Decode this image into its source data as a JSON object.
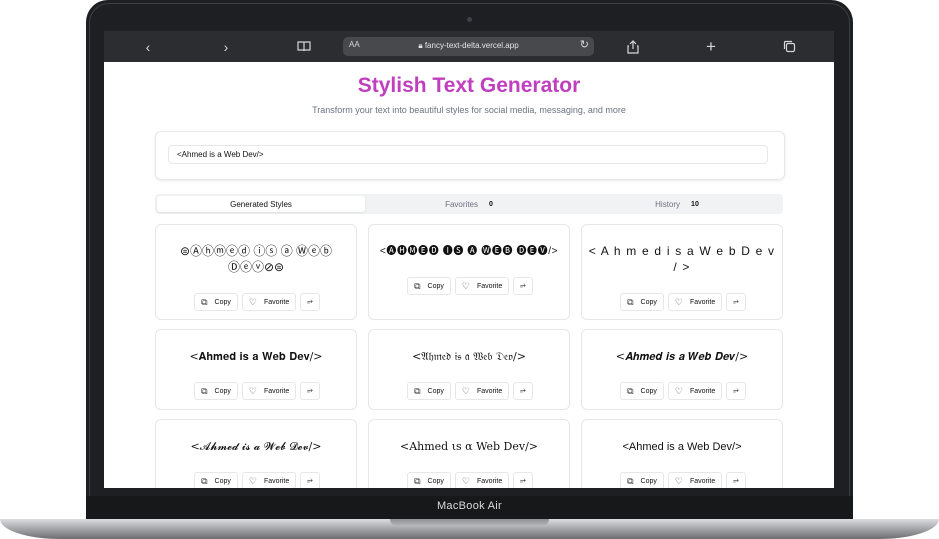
{
  "device": {
    "label": "MacBook Air"
  },
  "browser": {
    "text_size": "AA",
    "url": "fancy-text-delta.vercel.app",
    "icons": [
      "back-icon",
      "forward-icon",
      "reader-icon",
      "lock-icon",
      "reload-icon",
      "share-icon",
      "new-tab-icon",
      "tabs-icon"
    ]
  },
  "page": {
    "title": "Stylish Text Generator",
    "subtitle": "Transform your text into beautiful styles for social media, messaging, and more",
    "title_color": "#bf3fbf",
    "input_value": "<Ahmed is a Web Dev/>"
  },
  "tabs": [
    {
      "label": "Generated Styles",
      "count": ""
    },
    {
      "label": "Favorites",
      "count": "0"
    },
    {
      "label": "History",
      "count": "10"
    }
  ],
  "actions": {
    "copy": "Copy",
    "favorite": "Favorite"
  },
  "styles": [
    {
      "text": "⊜Ⓐⓗⓜⓔⓓ ⓘⓢ ⓐ Ⓦⓔⓑ Ⓓⓔⓥ⊘⊜"
    },
    {
      "text": "<🅐🅗🅜🅔🅓 🅘🅢 🅐 🅦🅔🅑 🅓🅔🅥/>"
    },
    {
      "text": "< A h m e d  i s  a  W e b  D e v / >"
    },
    {
      "text": "<𝐀𝐡𝐦𝐞𝐝 𝐢𝐬 𝐚 𝐖𝐞𝐛 𝐃𝐞𝐯/>"
    },
    {
      "text": "<𝔄𝔥𝔪𝔢𝔡 𝔦𝔰 𝔞 𝔚𝔢𝔟 𝔇𝔢𝔳/>"
    },
    {
      "text": "<𝑨𝒉𝒎𝒆𝒅 𝒊𝒔 𝒂 𝑾𝒆𝒃 𝑫𝒆𝒗/>"
    },
    {
      "text": "<𝓐𝓱𝓶𝓮𝓭 𝓲𝓼 𝓪 𝓦𝓮𝓫 𝓓𝓮𝓿/>"
    },
    {
      "text": "<Ahmed ιs α Web Dev/>"
    },
    {
      "text": "<Ahmed is a Web Dev/>"
    }
  ]
}
